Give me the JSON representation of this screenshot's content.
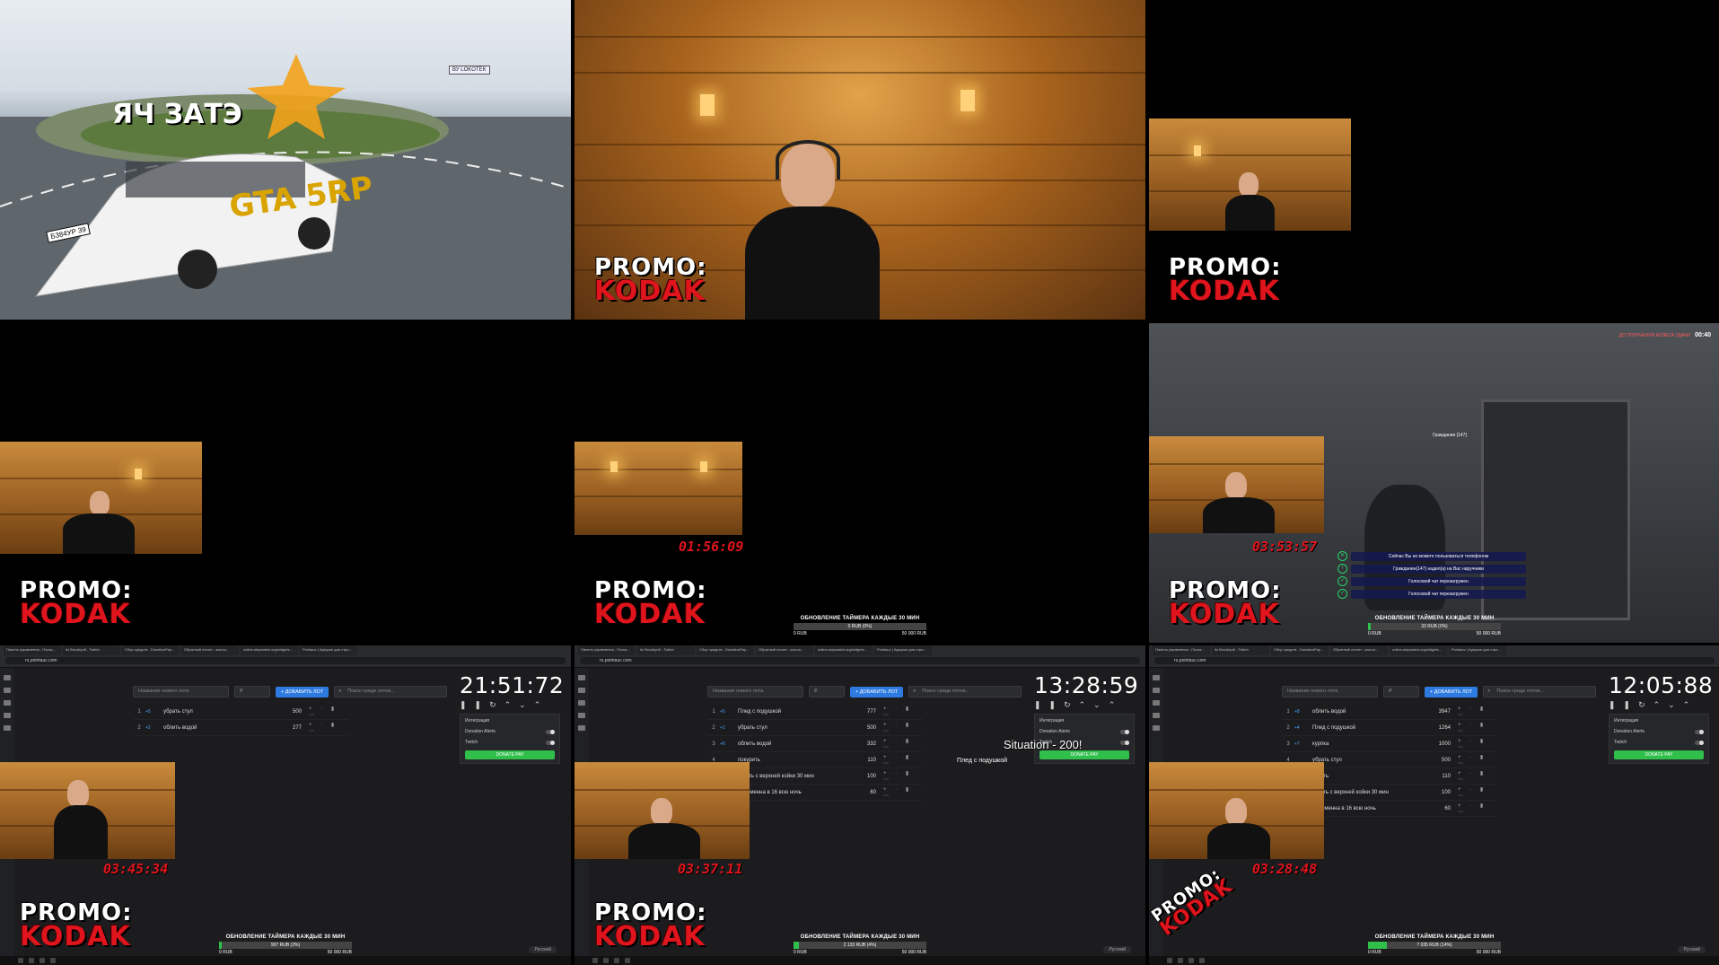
{
  "promo": {
    "line1": "PROMO:",
    "line2": "KODAK"
  },
  "tile1": {
    "logo_text": "GTA 5RP",
    "plate": "Б384УР 39",
    "road_sign": "ВУ LOKOTEK",
    "board_text": "ЯЧ ЗАТЭ"
  },
  "timers": {
    "t5": "01:56:09",
    "t6": "03:53:57",
    "t7": "03:45:34",
    "t8": "03:37:11",
    "t9": "03:28:48"
  },
  "progress": {
    "title": "ОБНОВЛЕНИЕ ТАЙМЕРА КАЖДЫЕ 30 МИН",
    "t5": {
      "label": "0 RUB (0%)",
      "min": "0 RUB",
      "max": "50 000 RUB",
      "fraction": 0
    },
    "t6": {
      "label": "33 RUB (0%)",
      "min": "0 RUB",
      "max": "50 000 RUB",
      "fraction": 0.01
    },
    "t7": {
      "label": "907 RUB (2%)",
      "min": "0 RUB",
      "max": "50 000 RUB",
      "fraction": 0.02
    },
    "t8": {
      "label": "2 133 RUB (4%)",
      "min": "0 RUB",
      "max": "50 000 RUB",
      "fraction": 0.04
    },
    "t9": {
      "label": "7 035 RUB (14%)",
      "min": "0 RUB",
      "max": "50 000 RUB",
      "fraction": 0.14
    }
  },
  "game": {
    "hud_top": "ДО ПОЛУЧЕНИЯ КОЛЕСА УДАЧИ",
    "hud_time": "00:40",
    "npc_label": "Гражданин [147]",
    "chat": [
      {
        "icon": "✕",
        "text": "Сейчас Вы не можете пользоваться телефоном"
      },
      {
        "icon": "!",
        "text": "Гражданин(147) надел(а) на Вас наручники"
      },
      {
        "icon": "✓",
        "text": "Голосовой чат перезагружен"
      },
      {
        "icon": "✓",
        "text": "Голосовой чат перезагружен"
      }
    ]
  },
  "browser": {
    "url": "ru.pointauc.com",
    "tabs": [
      "Панель управления - Поиск...",
      "itz Brooklyn8 - Twitch",
      "Сбор средств - DonationPay...",
      "Обратный отсчет - ксм.ко...",
      "online-stopwatch.org/widgets...",
      "Pointauc | Аукцион для стри..."
    ],
    "lot_placeholder": "Название нового лота",
    "amount_placeholder": "₽",
    "add_button": "+ ДОБАВИТЬ ЛОТ",
    "search_placeholder": "Поиск среди лотов...",
    "integration_label": "Интеграция",
    "donation_alerts": "Donation Alerts",
    "twitch": "Twitch",
    "donate_button": "DONATE PAY",
    "lang": "Русский"
  },
  "auction7": {
    "clock": "21:51:72",
    "lots": [
      {
        "num": "1",
        "ext": "+5",
        "name": "убрать стул",
        "amount": "500"
      },
      {
        "num": "2",
        "ext": "+2",
        "name": "облить водой",
        "amount": "277"
      }
    ]
  },
  "auction8": {
    "clock": "13:28:59",
    "overlay": "Situation - 200!",
    "overlay2": "Плед с подушкой",
    "lots": [
      {
        "num": "1",
        "ext": "+5",
        "name": "Плед с подушкой",
        "amount": "777"
      },
      {
        "num": "2",
        "ext": "+1",
        "name": "убрать стул",
        "amount": "500"
      },
      {
        "num": "3",
        "ext": "+6",
        "name": "облить водой",
        "amount": "332"
      },
      {
        "num": "4",
        "ext": "",
        "name": "покурить",
        "amount": "110"
      },
      {
        "num": "5",
        "ext": "",
        "name": "играть с верхней койки 30 мин",
        "amount": "100"
      },
      {
        "num": "6",
        "ext": "",
        "name": "беременна в 16 всю ночь",
        "amount": "60"
      }
    ]
  },
  "auction9": {
    "clock": "12:05:88",
    "lots": [
      {
        "num": "1",
        "ext": "+8",
        "name": "облить водой",
        "amount": "3947"
      },
      {
        "num": "2",
        "ext": "+4",
        "name": "Плед с подушкой",
        "amount": "1264"
      },
      {
        "num": "3",
        "ext": "+7",
        "name": "курпка",
        "amount": "1000"
      },
      {
        "num": "4",
        "ext": "",
        "name": "убрать стул",
        "amount": "500"
      },
      {
        "num": "5",
        "ext": "",
        "name": "курить",
        "amount": "110"
      },
      {
        "num": "6",
        "ext": "",
        "name": "играть с верхней койки 30 мин",
        "amount": "100"
      },
      {
        "num": "7",
        "ext": "",
        "name": "беременна в 16 всю ночь",
        "amount": "60"
      }
    ]
  },
  "colors": {
    "promo_red": "#e0141c",
    "progress_green": "#2fbf4a",
    "accent_blue": "#2d7be0"
  }
}
